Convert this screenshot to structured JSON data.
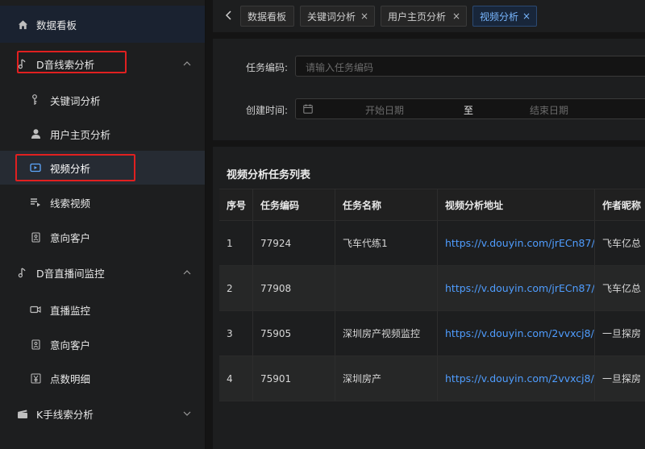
{
  "sidebar": {
    "items": [
      {
        "label": "数据看板",
        "icon": "home-icon"
      },
      {
        "label": "D音线索分析",
        "icon": "music-note-icon"
      },
      {
        "label": "关键词分析",
        "icon": "key-icon"
      },
      {
        "label": "用户主页分析",
        "icon": "user-icon"
      },
      {
        "label": "视频分析",
        "icon": "video-icon"
      },
      {
        "label": "线索视频",
        "icon": "list-play-icon"
      },
      {
        "label": "意向客户",
        "icon": "contact-card-icon"
      },
      {
        "label": "D音直播间监控",
        "icon": "music-note-icon"
      },
      {
        "label": "直播监控",
        "icon": "camera-icon"
      },
      {
        "label": "意向客户",
        "icon": "contact-card-icon"
      },
      {
        "label": "点数明细",
        "icon": "yen-icon"
      },
      {
        "label": "K手线索分析",
        "icon": "clapperboard-icon"
      }
    ]
  },
  "tabs": [
    {
      "label": "数据看板"
    },
    {
      "label": "关键词分析",
      "close": "×"
    },
    {
      "label": "用户主页分析",
      "close": "×"
    },
    {
      "label": "视频分析",
      "close": "×"
    }
  ],
  "filter": {
    "task_code_label": "任务编码:",
    "task_code_placeholder": "请输入任务编码",
    "created_label": "创建时间:",
    "start_placeholder": "开始日期",
    "separator": "至",
    "end_placeholder": "结束日期"
  },
  "table": {
    "title": "视频分析任务列表",
    "columns": [
      "序号",
      "任务编码",
      "任务名称",
      "视频分析地址",
      "作者昵称"
    ],
    "rows": [
      [
        "1",
        "77924",
        "飞车代练1",
        "https://v.douyin.com/jrECn87/",
        "飞车亿总"
      ],
      [
        "2",
        "77908",
        "",
        "https://v.douyin.com/jrECn87/",
        "飞车亿总"
      ],
      [
        "3",
        "75905",
        "深圳房产视频监控",
        "https://v.douyin.com/2vvxcj8/",
        "一旦探房"
      ],
      [
        "4",
        "75901",
        "深圳房产",
        "https://v.douyin.com/2vvxcj8/",
        "一旦探房"
      ]
    ]
  },
  "colors": {
    "accent": "#4f9dff",
    "highlight_box": "#e02020"
  }
}
